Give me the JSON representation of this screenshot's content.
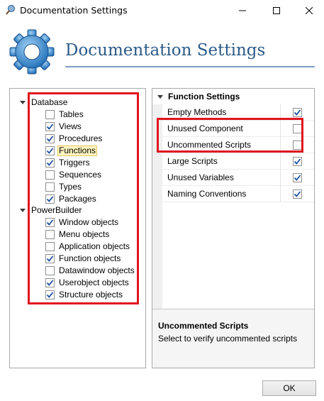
{
  "window": {
    "title": "Documentation Settings"
  },
  "header": {
    "title": "Documentation Settings",
    "icon": "gear-icon",
    "accent_color": "#2b5a88"
  },
  "tree": {
    "groups": [
      {
        "label": "Database",
        "expanded": true,
        "items": [
          {
            "label": "Tables",
            "checked": false
          },
          {
            "label": "Views",
            "checked": true
          },
          {
            "label": "Procedures",
            "checked": true
          },
          {
            "label": "Functions",
            "checked": true,
            "selected": true
          },
          {
            "label": "Triggers",
            "checked": true
          },
          {
            "label": "Sequences",
            "checked": false
          },
          {
            "label": "Types",
            "checked": false
          },
          {
            "label": "Packages",
            "checked": true
          }
        ]
      },
      {
        "label": "PowerBuilder",
        "expanded": true,
        "items": [
          {
            "label": "Window objects",
            "checked": true
          },
          {
            "label": "Menu objects",
            "checked": false
          },
          {
            "label": "Application objects",
            "checked": false
          },
          {
            "label": "Function objects",
            "checked": true
          },
          {
            "label": "Datawindow objects",
            "checked": false
          },
          {
            "label": "Userobject objects",
            "checked": true
          },
          {
            "label": "Structure objects",
            "checked": true
          }
        ]
      }
    ]
  },
  "properties": {
    "category": "Function Settings",
    "rows": [
      {
        "name": "Empty Methods",
        "checked": true
      },
      {
        "name": "Unused Component",
        "checked": false
      },
      {
        "name": "Uncommented Scripts",
        "checked": false
      },
      {
        "name": "Large Scripts",
        "checked": true
      },
      {
        "name": "Unused Variables",
        "checked": true
      },
      {
        "name": "Naming Conventions",
        "checked": true
      }
    ],
    "description": {
      "title": "Uncommented Scripts",
      "text": "Select to verify uncommented scripts"
    }
  },
  "footer": {
    "ok_label": "OK"
  },
  "colors": {
    "highlight": "#e0141e",
    "selection_bg": "#fff6c0",
    "check": "#1e4f9c"
  }
}
